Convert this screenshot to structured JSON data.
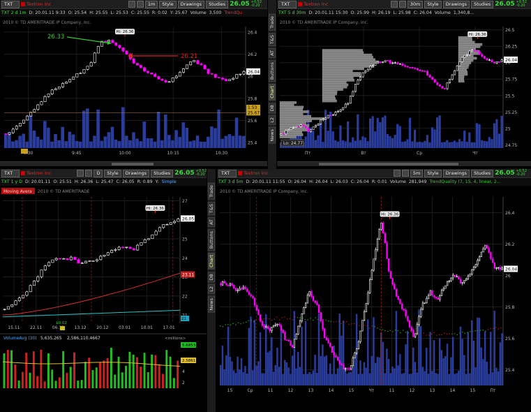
{
  "colors": {
    "up": "#ffffff",
    "down": "#ff00ff",
    "price": "#33dd33",
    "volume": "#2a3d9c",
    "grid": "#222",
    "annot_green": "#33cc33",
    "annot_red": "#dd2222"
  },
  "panes": [
    {
      "id": "p1",
      "symbol": "TXT",
      "company": "Textron Inc",
      "tf_btn": "1m",
      "study_tag": "TrendQu",
      "price": "26.05",
      "change": "+0.52",
      "change2": "-0.20",
      "title_sym": "TXT 2 d 1m",
      "info": [
        "D: 20.01.11 9:33",
        "O: 25.54",
        "H: 25.55",
        "L: 25.53",
        "C: 25.55",
        "R: 0.02",
        "Y: 25.67",
        "Volume",
        "3,500"
      ],
      "watermark": "2010 © TD AMERITRADE IP Company, Inc.",
      "hi_label": "Hi: 26.36",
      "annotations": {
        "left": "26.33",
        "right": "26.21"
      },
      "last_label": "26.04",
      "ref_label": "25.67",
      "vol_label": "1.53",
      "xticks": [
        "9:30",
        "9:45",
        "10:00",
        "10:15",
        "10:30"
      ],
      "yticks": [
        "26.4",
        "26.2",
        "26",
        "25.8",
        "25.6",
        "25.4"
      ]
    },
    {
      "id": "p2",
      "symbol": "TXT",
      "company": "Textron Inc",
      "tf_btn": "30m",
      "price": "26.05",
      "change": "+0.52",
      "change2": "-0.20",
      "title_sym": "TXT 5 d 30m",
      "info": [
        "D: 20.01.11 15:30",
        "O: 25.99",
        "H: 26.19",
        "L: 25.98",
        "C: 26.04",
        "Volume",
        "1,340,8..."
      ],
      "watermark": "2010 © TD AMERITRADE IP Company, Inc.",
      "hi_label": "Hi: 26.36",
      "lo_label": "Lo: 24.77",
      "last_label": "26.04",
      "xticks": [
        "Пт",
        "Вт",
        "Ср",
        "Чт"
      ],
      "yticks": [
        "26.5",
        "26.25",
        "26",
        "25.75",
        "25.5",
        "25.25",
        "25",
        "24.75"
      ]
    },
    {
      "id": "p3",
      "symbol": "TXT",
      "company": "Textron Inc",
      "tf_btn": "D",
      "price": "26.05",
      "change": "+0.52",
      "change2": "-0.20",
      "title_sym": "TXT 1 y D",
      "info": [
        "D: 20.01.11",
        "O: 25.51",
        "H: 26.36",
        "L: 25.47",
        "C: 26.05",
        "R: 0.89",
        "Y:",
        "Simple"
      ],
      "watermark": "2010 © TD AMERITRADE",
      "hi_label": "Hi: 26.36",
      "red_tag": "Moving Avera",
      "last_label": "26.05",
      "ma_label": "23.11",
      "ma2_label": "21",
      "low_tag": "$0.02",
      "xticks": [
        "15.11",
        "22.11",
        "06.12",
        "13.12",
        "20.12",
        "03.01",
        "10.01",
        "17.01"
      ],
      "yticks": [
        "27",
        "26",
        "25",
        "24",
        "23",
        "22",
        "21"
      ],
      "sub": {
        "title": "VolumeAvg (30)",
        "v1": "5,635,265",
        "v2": "2,586,110.4667",
        "unit": "<millions>",
        "upper": "5.6853",
        "lower": "2.5861",
        "yticks": [
          "4",
          "2"
        ]
      }
    },
    {
      "id": "p4",
      "symbol": "TXT",
      "company": "Textron Inc",
      "tf_btn": "5m",
      "price": "26.05",
      "change": "+0.52",
      "change2": "-0.20",
      "title_sym": "TXT 3 d 5m",
      "info": [
        "D: 20.01.11 11:55",
        "O: 26.04",
        "H: 26.04",
        "L: 26.03",
        "C: 26.04",
        "R: 0.01",
        "Volume",
        "281,949"
      ],
      "study_info": "TrendQuality (7, 15, 4, linear, 2...",
      "watermark": "2010 © TD AMERITRADE IP Company, Inc.",
      "hi_label": "Hi: 26.36",
      "last_label": "26.04",
      "xticks": [
        "15",
        "Ср",
        "11",
        "12",
        "13",
        "14",
        "15",
        "Чт",
        "11",
        "12",
        "13",
        "14",
        "15",
        "Пт"
      ],
      "yticks": [
        "26.4",
        "26.2",
        "26",
        "25.8",
        "25.6",
        "25.4"
      ]
    }
  ],
  "tabs": [
    "Trade",
    "T&S",
    "AT",
    "Buttons",
    "Chart",
    "DB",
    "L2",
    "News"
  ],
  "buttons": {
    "style": "Style",
    "drawings": "Drawings",
    "studies": "Studies"
  },
  "chart_data": [
    {
      "type": "candlestick",
      "title": "TXT 2 d 1m",
      "ylim": [
        25.35,
        26.45
      ],
      "series": [
        {
          "name": "Volume",
          "values": []
        }
      ],
      "x": [
        "9:30",
        "9:45",
        "10:00",
        "10:15",
        "10:30"
      ],
      "close_path": [
        25.48,
        25.52,
        25.6,
        25.67,
        25.75,
        25.85,
        25.9,
        25.95,
        26.0,
        26.05,
        26.12,
        26.3,
        26.33,
        26.28,
        26.21,
        26.12,
        26.06,
        26.02,
        25.98,
        25.95,
        26.0,
        26.08,
        26.15,
        26.1,
        26.02,
        25.98,
        25.96,
        26.0,
        26.04
      ],
      "levels": {
        "hi": 26.36,
        "last": 26.04,
        "ref": 25.67
      }
    },
    {
      "type": "candlestick",
      "title": "TXT 5 d 30m",
      "ylim": [
        24.7,
        26.55
      ],
      "close_path": [
        24.9,
        25.0,
        25.05,
        24.95,
        25.1,
        25.2,
        25.25,
        25.4,
        25.75,
        25.9,
        26.0,
        26.02,
        25.98,
        25.95,
        25.9,
        25.85,
        25.7,
        25.6,
        25.85,
        26.1,
        26.2,
        26.1,
        26.0,
        26.04
      ],
      "levels": {
        "hi": 26.36,
        "lo": 24.77,
        "last": 26.04
      }
    },
    {
      "type": "candlestick",
      "title": "TXT 1 y D",
      "ylim": [
        20.6,
        27.2
      ],
      "close_path": [
        21.3,
        21.5,
        21.9,
        22.3,
        22.8,
        23.4,
        23.8,
        24.0,
        23.9,
        24.0,
        23.7,
        23.8,
        23.9,
        24.1,
        24.3,
        24.5,
        24.6,
        24.4,
        24.8,
        25.0,
        25.4,
        25.7,
        25.9,
        26.05
      ],
      "levels": {
        "hi": 26.36,
        "last": 26.05,
        "ma": 23.11
      },
      "sub": {
        "type": "bar",
        "name": "VolumeAvg (30)",
        "upper": 5.6853,
        "lower": 2.5861
      }
    },
    {
      "type": "candlestick",
      "title": "TXT 3 d 5m",
      "ylim": [
        25.3,
        26.5
      ],
      "close_path": [
        25.95,
        25.95,
        25.9,
        25.93,
        25.85,
        25.7,
        25.65,
        25.7,
        25.6,
        25.55,
        25.75,
        25.9,
        25.8,
        25.6,
        25.5,
        25.42,
        25.4,
        25.55,
        25.8,
        26.1,
        26.35,
        26.0,
        25.85,
        25.75,
        25.6,
        25.8,
        25.9,
        25.85,
        25.95,
        26.0,
        25.95,
        26.0,
        26.1,
        26.2,
        26.05,
        26.04
      ],
      "levels": {
        "hi": 26.36,
        "last": 26.04
      }
    }
  ]
}
